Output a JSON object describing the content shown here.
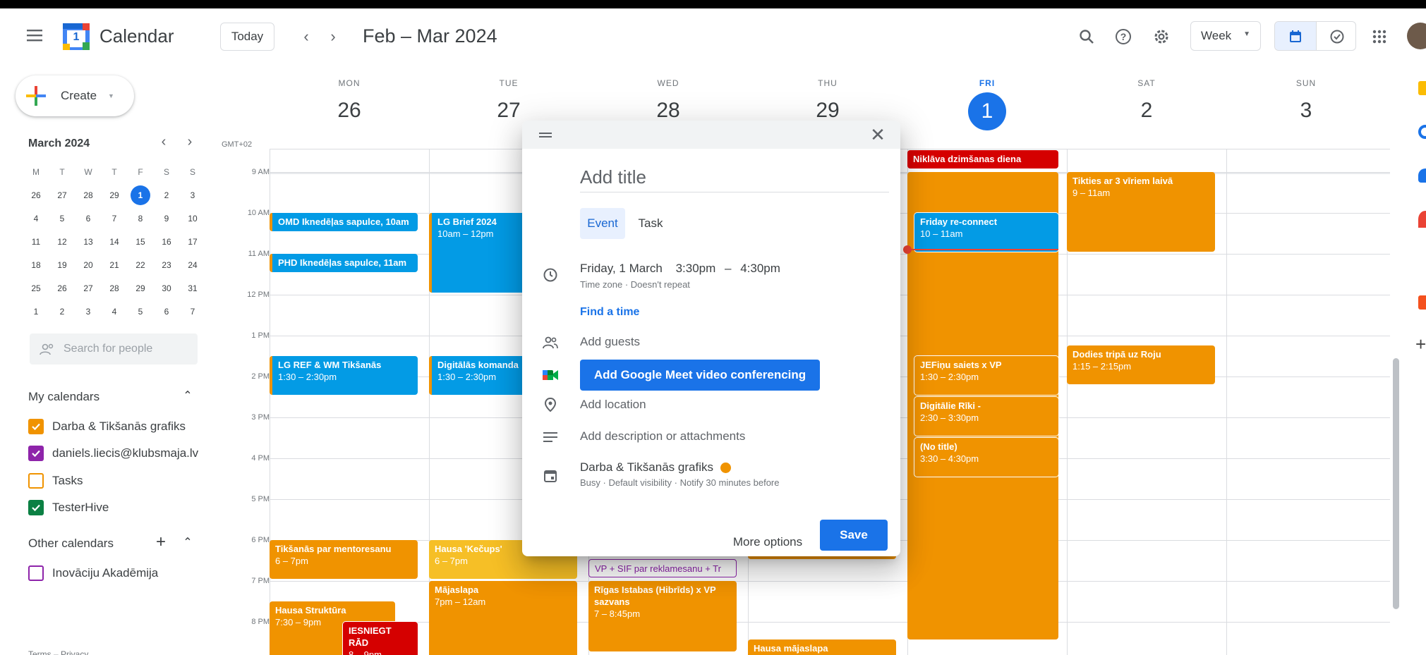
{
  "header": {
    "app_title": "Calendar",
    "logo_day": "1",
    "today_label": "Today",
    "date_range": "Feb – Mar 2024",
    "view_select": "Week"
  },
  "sidebar": {
    "create_label": "Create",
    "mini_month": "March 2024",
    "mini_dow": [
      "M",
      "T",
      "W",
      "T",
      "F",
      "S",
      "S"
    ],
    "mini_weeks": [
      [
        "26",
        "27",
        "28",
        "29",
        "1",
        "2",
        "3"
      ],
      [
        "4",
        "5",
        "6",
        "7",
        "8",
        "9",
        "10"
      ],
      [
        "11",
        "12",
        "13",
        "14",
        "15",
        "16",
        "17"
      ],
      [
        "18",
        "19",
        "20",
        "21",
        "22",
        "23",
        "24"
      ],
      [
        "25",
        "26",
        "27",
        "28",
        "29",
        "30",
        "31"
      ],
      [
        "1",
        "2",
        "3",
        "4",
        "5",
        "6",
        "7"
      ]
    ],
    "search_people_placeholder": "Search for people",
    "my_calendars_title": "My calendars",
    "my_calendars": [
      {
        "label": "Darba & Tikšanās grafiks",
        "color": "#f09300",
        "checked": true
      },
      {
        "label": "daniels.liecis@klubsmaja.lv",
        "color": "#8e24aa",
        "checked": true
      },
      {
        "label": "Tasks",
        "color": "#f09300",
        "checked": false
      },
      {
        "label": "TesterHive",
        "color": "#0b8043",
        "checked": true
      }
    ],
    "other_calendars_title": "Other calendars",
    "other_calendars": [
      {
        "label": "Inovāciju Akadēmija",
        "color": "#8e24aa",
        "checked": false
      }
    ],
    "footer": "Terms – Privacy"
  },
  "grid": {
    "timezone": "GMT+02",
    "days": [
      {
        "dow": "MON",
        "num": "26"
      },
      {
        "dow": "TUE",
        "num": "27"
      },
      {
        "dow": "WED",
        "num": "28"
      },
      {
        "dow": "THU",
        "num": "29"
      },
      {
        "dow": "FRI",
        "num": "1"
      },
      {
        "dow": "SAT",
        "num": "2"
      },
      {
        "dow": "SUN",
        "num": "3"
      }
    ],
    "hours": [
      "9 AM",
      "10 AM",
      "11 AM",
      "12 PM",
      "1 PM",
      "2 PM",
      "3 PM",
      "4 PM",
      "5 PM",
      "6 PM",
      "7 PM",
      "8 PM"
    ],
    "events": {
      "e1": {
        "title": "OMD Iknedēļas sapulce, 10am",
        "time": ""
      },
      "e2": {
        "title": "PHD Iknedēļas sapulce, 11am",
        "time": ""
      },
      "e3": {
        "title": "LG Brief 2024",
        "time": "10am – 12pm"
      },
      "e4": {
        "title": "LG REF & WM Tikšanās",
        "time": "1:30 – 2:30pm"
      },
      "e5": {
        "title": "Digitālās komanda",
        "time": "1:30 – 2:30pm"
      },
      "e6": {
        "title": "Tikšanās par mentoresanu",
        "time": "6 – 7pm"
      },
      "e7": {
        "title": "Hausa 'Kečups'",
        "time": "6 – 7pm"
      },
      "e8": {
        "title": "Mājaslapa",
        "time": "7pm – 12am"
      },
      "e9": {
        "title": "Hausa Struktūra",
        "time": "7:30 – 9pm"
      },
      "e10": {
        "title": "IESNIEGT RĀD",
        "time": "8 – 9pm"
      },
      "e11": {
        "title": "VP + SIF par reklamesanu + Tr",
        "time": ""
      },
      "e12": {
        "title": "Rīgas Istabas (Hibrīds) x VP sazvans",
        "time": "7 – 8:45pm"
      },
      "e13": {
        "title": "Hausa mājaslapa",
        "time": ""
      },
      "e14": {
        "title": "Niklāva dzimšanas diena",
        "time": ""
      },
      "e15": {
        "title": "Friday re-connect",
        "time": "10 – 11am"
      },
      "e16": {
        "title": "JEFiņu saiets x VP",
        "time": "1:30 – 2:30pm"
      },
      "e17": {
        "title": "Digitālie Rīki -",
        "time": "2:30 – 3:30pm"
      },
      "e18": {
        "title": "(No title)",
        "time": "3:30 – 4:30pm"
      },
      "e19": {
        "title": "Tikties ar 3 vīriem laivā",
        "time": "9 – 11am"
      },
      "e20": {
        "title": "Dodies tripā uz Roju",
        "time": "1:15 – 2:15pm"
      }
    }
  },
  "dialog": {
    "title_placeholder": "Add title",
    "tab_event": "Event",
    "tab_task": "Task",
    "date": "Friday, 1 March",
    "time_start": "3:30pm",
    "time_sep": "–",
    "time_end": "4:30pm",
    "tz_repeat": "Time zone · Doesn't repeat",
    "find_time": "Find a time",
    "add_guests": "Add guests",
    "meet_button": "Add Google Meet video conferencing",
    "add_location": "Add location",
    "add_description": "Add description or attachments",
    "calendar_name": "Darba & Tikšanās grafiks",
    "calendar_color": "#f09300",
    "calendar_meta": "Busy · Default visibility · Notify 30 minutes before",
    "more_options": "More options",
    "save": "Save"
  }
}
